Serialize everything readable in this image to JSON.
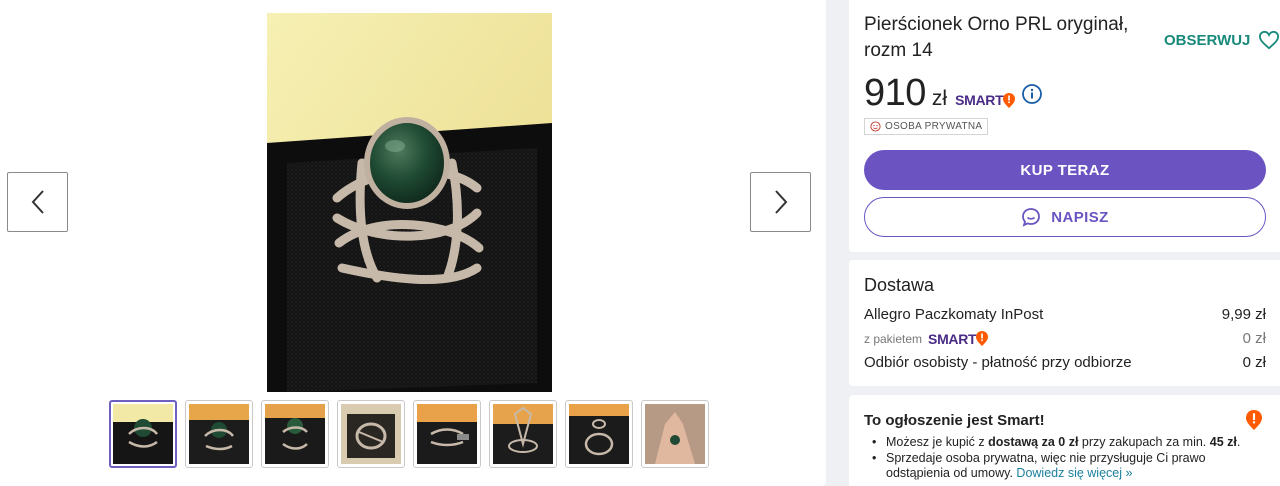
{
  "gallery": {
    "prev_label": "previous-photo",
    "next_label": "next-photo",
    "thumbnail_count": 8
  },
  "offer": {
    "title": "Pierścionek Orno PRL oryginał, rozm 14",
    "follow_label": "OBSERWUJ",
    "price": "910",
    "currency": "zł",
    "smart_label": "SMART",
    "seller_badge": "OSOBA PRYWATNA",
    "buy_label": "KUP TERAZ",
    "message_label": "NAPISZ"
  },
  "delivery": {
    "title": "Dostawa",
    "rows": [
      {
        "label": "Allegro Paczkomaty InPost",
        "value": "9,99 zł"
      },
      {
        "label": "z pakietem",
        "value": "0 zł"
      },
      {
        "label": "Odbiór osobisty - płatność przy odbiorze",
        "value": "0 zł"
      }
    ]
  },
  "smart_box": {
    "title": "To ogłoszenie jest Smart!",
    "line1_pre": "Możesz je kupić z ",
    "line1_bold": "dostawą za 0 zł",
    "line1_mid": " przy zakupach za min. ",
    "line1_bold2": "45 zł",
    "line1_end": ".",
    "line2": "Sprzedaje osoba prywatna, więc nie przysługuje Ci prawo odstąpienia od umowy.",
    "line2_link": "Dowiedz się więcej »"
  },
  "colors": {
    "accent_purple": "#6b54c2",
    "teal": "#19897c",
    "smart_orange": "#ff5a00",
    "smart_purple": "#4a2b85"
  }
}
